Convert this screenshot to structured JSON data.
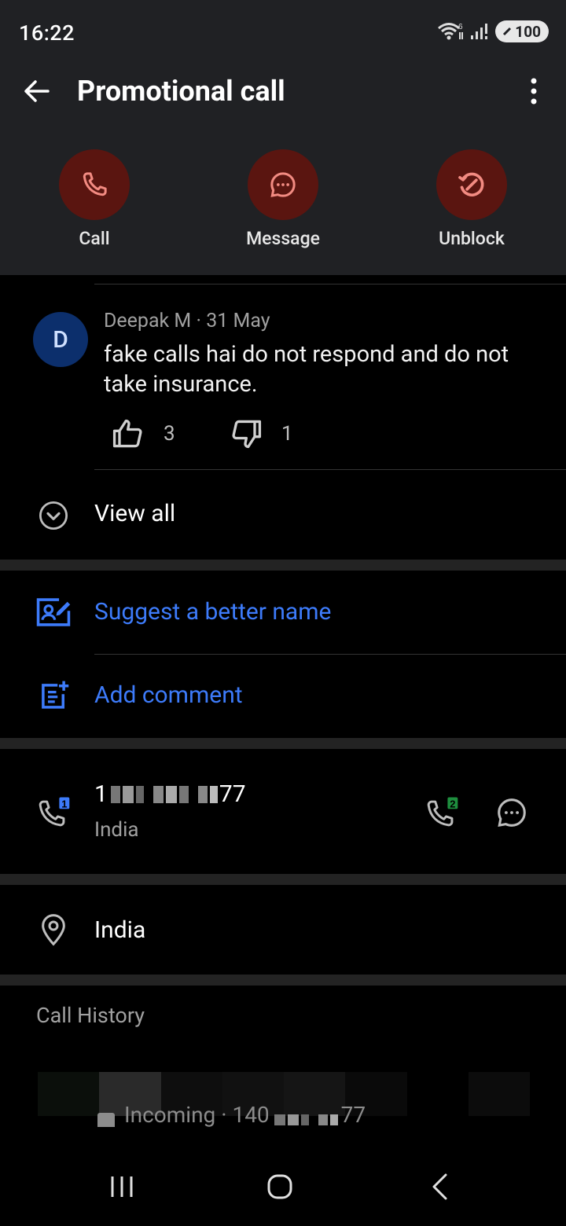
{
  "status_bar": {
    "time": "16:22",
    "battery": "100",
    "network_label": "6"
  },
  "header": {
    "title": "Promotional call"
  },
  "actions": [
    {
      "label": "Call",
      "icon": "phone-icon"
    },
    {
      "label": "Message",
      "icon": "chat-bubble-icon"
    },
    {
      "label": "Unblock",
      "icon": "unblock-icon"
    }
  ],
  "comment": {
    "avatar_initial": "D",
    "meta": "Deepak M · 31 May",
    "text": "fake calls hai do not respond and do not take insurance.",
    "likes": "3",
    "dislikes": "1"
  },
  "view_all": {
    "label": "View all"
  },
  "suggest": {
    "label": "Suggest a better name"
  },
  "add_comment": {
    "label": "Add comment"
  },
  "number": {
    "value_prefix": "1",
    "value_suffix": "77",
    "country": "India",
    "sim1_badge": "1",
    "sim2_badge": "2"
  },
  "location": {
    "label": "India"
  },
  "call_history": {
    "title": "Call History",
    "entry_prefix": "Incoming · 140",
    "entry_suffix": "77"
  },
  "colors": {
    "accent_blue": "#3d7bfa",
    "action_circle": "#5a1510",
    "action_icon": "#f28b82",
    "avatar_bg": "#0c2f6c"
  }
}
